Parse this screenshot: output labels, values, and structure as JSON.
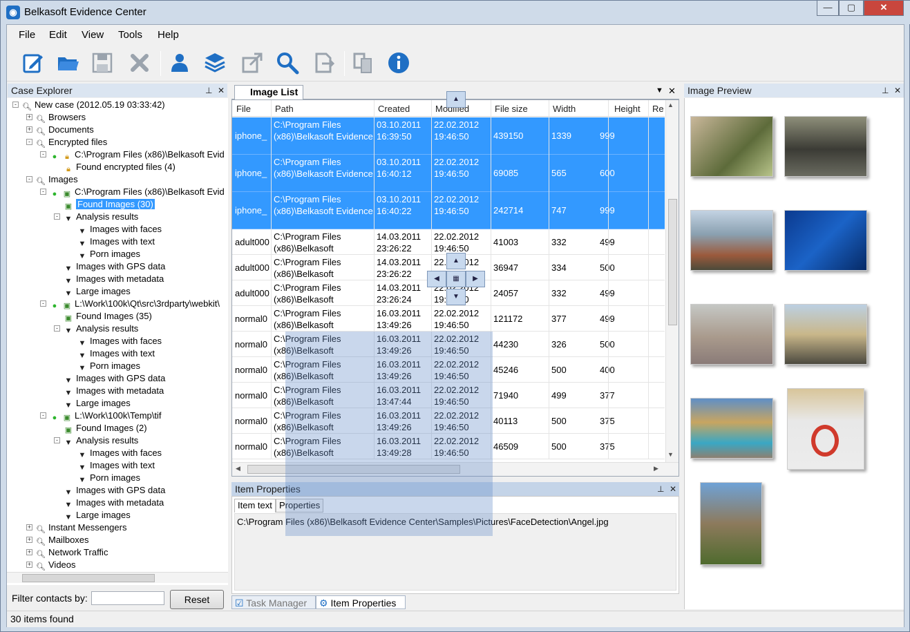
{
  "window": {
    "title": "Belkasoft Evidence Center",
    "minimize": "—",
    "maximize": "▢",
    "close": "✕"
  },
  "menu": [
    {
      "label": "File"
    },
    {
      "label": "Edit"
    },
    {
      "label": "View"
    },
    {
      "label": "Tools"
    },
    {
      "label": "Help"
    }
  ],
  "toolbar": [
    "new-case-icon",
    "open-icon",
    "save-icon",
    "delete-icon",
    "user-icon",
    "layers-icon",
    "export-icon",
    "search-icon",
    "forward-icon",
    "copy-icon",
    "info-icon"
  ],
  "case_explorer": {
    "title": "Case Explorer",
    "pin": "⊥",
    "close": "✕",
    "nodes": [
      {
        "label": "New case (2012.05.19 03:33:42)"
      },
      {
        "label": "Browsers"
      },
      {
        "label": "Documents"
      },
      {
        "label": "Encrypted files"
      },
      {
        "label": "C:\\Program Files (x86)\\Belkasoft Evid"
      },
      {
        "label": "Found encrypted files (4)"
      },
      {
        "label": "Images"
      },
      {
        "label": "C:\\Program Files (x86)\\Belkasoft Evid"
      },
      {
        "label": "Found Images (30)"
      },
      {
        "label": "Analysis results"
      },
      {
        "label": "Images with faces"
      },
      {
        "label": "Images with text"
      },
      {
        "label": "Porn images"
      },
      {
        "label": "Images with GPS data"
      },
      {
        "label": "Images with metadata"
      },
      {
        "label": "Large images"
      },
      {
        "label": "L:\\Work\\100k\\Qt\\src\\3rdparty\\webkit\\"
      },
      {
        "label": "Found Images (35)"
      },
      {
        "label": "Analysis results"
      },
      {
        "label": "Images with faces"
      },
      {
        "label": "Images with text"
      },
      {
        "label": "Porn images"
      },
      {
        "label": "Images with GPS data"
      },
      {
        "label": "Images with metadata"
      },
      {
        "label": "Large images"
      },
      {
        "label": "L:\\Work\\100k\\Temp\\tif"
      },
      {
        "label": "Found Images (2)"
      },
      {
        "label": "Analysis results"
      },
      {
        "label": "Images with faces"
      },
      {
        "label": "Images with text"
      },
      {
        "label": "Porn images"
      },
      {
        "label": "Images with GPS data"
      },
      {
        "label": "Images with metadata"
      },
      {
        "label": "Large images"
      },
      {
        "label": "Instant Messengers"
      },
      {
        "label": "Mailboxes"
      },
      {
        "label": "Network Traffic"
      },
      {
        "label": "Videos"
      }
    ],
    "filter_label": "Filter contacts by:",
    "filter_value": "",
    "reset_label": "Reset"
  },
  "image_list": {
    "tab": "Image List",
    "columns": [
      "File",
      "Path",
      "Created",
      "Modified",
      "File size",
      "Width",
      "Height",
      "Re"
    ],
    "rows": [
      {
        "file": "iphone_",
        "path": "C:\\Program Files (x86)\\Belkasoft Evidence",
        "created": "03.10.2011 16:39:50",
        "modified": "22.02.2012 19:46:50",
        "size": "439150",
        "width": "1339",
        "height": "999",
        "selected": true
      },
      {
        "file": "iphone_",
        "path": "C:\\Program Files (x86)\\Belkasoft Evidence",
        "created": "03.10.2011 16:40:12",
        "modified": "22.02.2012 19:46:50",
        "size": "69085",
        "width": "565",
        "height": "600",
        "selected": true
      },
      {
        "file": "iphone_",
        "path": "C:\\Program Files (x86)\\Belkasoft Evidence",
        "created": "03.10.2011 16:40:22",
        "modified": "22.02.2012 19:46:50",
        "size": "242714",
        "width": "747",
        "height": "999",
        "selected": true
      },
      {
        "file": "adult000",
        "path": "C:\\Program Files (x86)\\Belkasoft",
        "created": "14.03.2011 23:26:22",
        "modified": "22.02.2012 19:46:50",
        "size": "41003",
        "width": "332",
        "height": "499"
      },
      {
        "file": "adult000",
        "path": "C:\\Program Files (x86)\\Belkasoft",
        "created": "14.03.2011 23:26:22",
        "modified": "22.02.2012 19:46:50",
        "size": "36947",
        "width": "334",
        "height": "500"
      },
      {
        "file": "adult000",
        "path": "C:\\Program Files (x86)\\Belkasoft",
        "created": "14.03.2011 23:26:24",
        "modified": "22.02.2012 19:46:50",
        "size": "24057",
        "width": "332",
        "height": "499"
      },
      {
        "file": "normal0",
        "path": "C:\\Program Files (x86)\\Belkasoft",
        "created": "16.03.2011 13:49:26",
        "modified": "22.02.2012 19:46:50",
        "size": "121172",
        "width": "377",
        "height": "499"
      },
      {
        "file": "normal0",
        "path": "C:\\Program Files (x86)\\Belkasoft",
        "created": "16.03.2011 13:49:26",
        "modified": "22.02.2012 19:46:50",
        "size": "44230",
        "width": "326",
        "height": "500"
      },
      {
        "file": "normal0",
        "path": "C:\\Program Files (x86)\\Belkasoft",
        "created": "16.03.2011 13:49:26",
        "modified": "22.02.2012 19:46:50",
        "size": "45246",
        "width": "500",
        "height": "400"
      },
      {
        "file": "normal0",
        "path": "C:\\Program Files (x86)\\Belkasoft",
        "created": "16.03.2011 13:47:44",
        "modified": "22.02.2012 19:46:50",
        "size": "71940",
        "width": "499",
        "height": "377"
      },
      {
        "file": "normal0",
        "path": "C:\\Program Files (x86)\\Belkasoft",
        "created": "16.03.2011 13:49:26",
        "modified": "22.02.2012 19:46:50",
        "size": "40113",
        "width": "500",
        "height": "375"
      },
      {
        "file": "normal0",
        "path": "C:\\Program Files (x86)\\Belkasoft",
        "created": "16.03.2011 13:49:28",
        "modified": "22.02.2012 19:46:50",
        "size": "46509",
        "width": "500",
        "height": "375"
      }
    ]
  },
  "item_properties": {
    "title": "Item Properties",
    "tabs": [
      "Item text",
      "Properties"
    ],
    "text": "C:\\Program Files (x86)\\Belkasoft Evidence Center\\Samples\\Pictures\\FaceDetection\\Angel.jpg"
  },
  "bottom_tabs": [
    "Task Manager",
    "Item Properties"
  ],
  "image_preview": {
    "title": "Image Preview",
    "thumbnail_count": 9
  },
  "status": {
    "text": "30 items found"
  },
  "colors": {
    "selection": "#3399ff",
    "pane_header": "#dbe5f1",
    "toolbar_icon": "#1f6fc4"
  }
}
